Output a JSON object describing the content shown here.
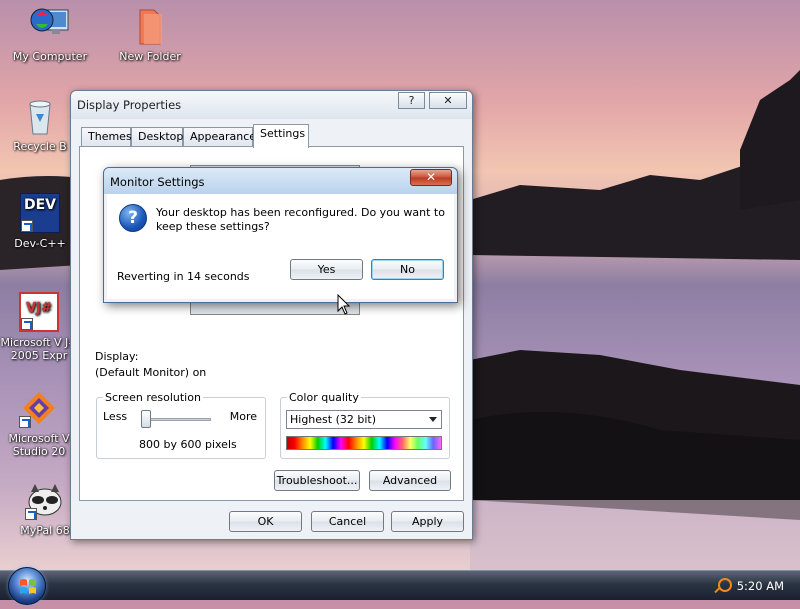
{
  "desktop": {
    "icons": [
      {
        "label": "My Computer",
        "icon": "computer-icon"
      },
      {
        "label": "New Folder",
        "icon": "folder-icon"
      },
      {
        "label": "Recycle B",
        "icon": "recycle-bin-icon"
      },
      {
        "label": "Dev-C++",
        "icon": "dev-cpp-icon",
        "badge": "DEV"
      },
      {
        "label": "Microsoft V J# 2005 Expr",
        "icon": "vj-sharp-icon",
        "badge": "VJ#"
      },
      {
        "label": "Microsoft V Studio 20",
        "icon": "visual-studio-icon"
      },
      {
        "label": "MyPal 68",
        "icon": "mypal-raccoon-icon"
      }
    ]
  },
  "display_properties": {
    "title": "Display Properties",
    "help_button": "?",
    "close_button": "✕",
    "tabs": [
      "Themes",
      "Desktop",
      "Appearance",
      "Settings"
    ],
    "active_tab": "Settings",
    "display_label": "Display:",
    "display_value": "(Default Monitor) on",
    "screen_resolution": {
      "legend": "Screen resolution",
      "less": "Less",
      "more": "More",
      "value": "800 by 600 pixels"
    },
    "color_quality": {
      "legend": "Color quality",
      "selected": "Highest (32 bit)"
    },
    "buttons": {
      "troubleshoot": "Troubleshoot...",
      "advanced": "Advanced",
      "ok": "OK",
      "cancel": "Cancel",
      "apply": "Apply"
    }
  },
  "monitor_dialog": {
    "title": "Monitor Settings",
    "close_button": "✕",
    "message": "Your desktop has been reconfigured.  Do you want to keep these settings?",
    "countdown": "Reverting in 14 seconds",
    "yes": "Yes",
    "no": "No"
  },
  "taskbar": {
    "clock": "5:20 AM",
    "tray_icon": "search-icon"
  },
  "colors": {
    "accent": "#3c7fb1",
    "title_gradient_top": "#f5f8fb",
    "dialog_close": "#c9503a"
  }
}
